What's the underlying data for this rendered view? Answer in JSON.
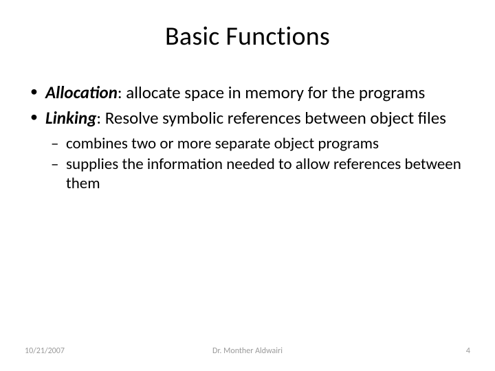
{
  "title": "Basic Functions",
  "bullets": [
    {
      "term": "Allocation",
      "text": ": allocate space in memory for the programs"
    },
    {
      "term": "Linking",
      "text": ": Resolve symbolic references between object files",
      "sub": [
        "combines two or more separate object programs",
        "supplies the information needed to allow references between them"
      ]
    }
  ],
  "footer": {
    "date": "10/21/2007",
    "author": "Dr. Monther Aldwairi",
    "page": "4"
  }
}
